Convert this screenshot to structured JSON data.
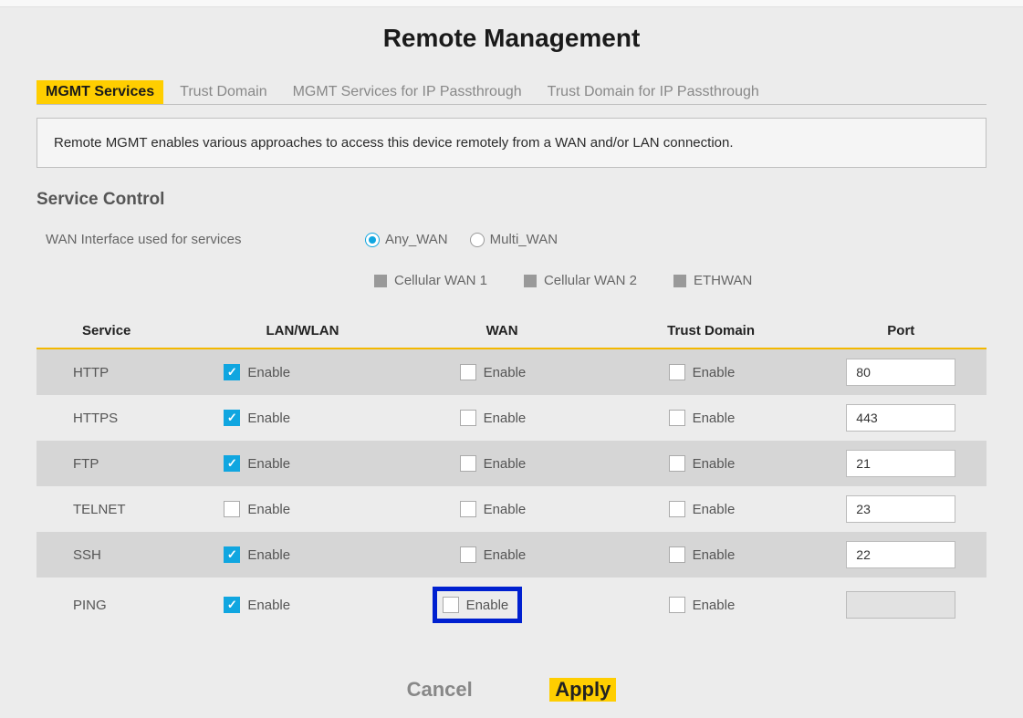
{
  "page": {
    "title": "Remote Management"
  },
  "tabs": {
    "items": [
      {
        "label": "MGMT Services",
        "active": true
      },
      {
        "label": "Trust Domain",
        "active": false
      },
      {
        "label": "MGMT Services for IP Passthrough",
        "active": false
      },
      {
        "label": "Trust Domain for IP Passthrough",
        "active": false
      }
    ]
  },
  "note": "Remote MGMT enables various approaches to access this device remotely from a WAN and/or LAN connection.",
  "section": {
    "title": "Service Control",
    "wan_label": "WAN Interface used for services",
    "wan_options": [
      {
        "label": "Any_WAN",
        "selected": true
      },
      {
        "label": "Multi_WAN",
        "selected": false
      }
    ],
    "legend": [
      {
        "label": "Cellular WAN 1"
      },
      {
        "label": "Cellular WAN 2"
      },
      {
        "label": "ETHWAN"
      }
    ]
  },
  "table": {
    "headers": [
      "Service",
      "LAN/WLAN",
      "WAN",
      "Trust Domain",
      "Port"
    ],
    "enable_label": "Enable",
    "rows": [
      {
        "service": "HTTP",
        "lan": true,
        "wan": false,
        "trust": false,
        "port": "80",
        "highlight_wan": false
      },
      {
        "service": "HTTPS",
        "lan": true,
        "wan": false,
        "trust": false,
        "port": "443",
        "highlight_wan": false
      },
      {
        "service": "FTP",
        "lan": true,
        "wan": false,
        "trust": false,
        "port": "21",
        "highlight_wan": false
      },
      {
        "service": "TELNET",
        "lan": false,
        "wan": false,
        "trust": false,
        "port": "23",
        "highlight_wan": false
      },
      {
        "service": "SSH",
        "lan": true,
        "wan": false,
        "trust": false,
        "port": "22",
        "highlight_wan": false
      },
      {
        "service": "PING",
        "lan": true,
        "wan": false,
        "trust": false,
        "port": "",
        "highlight_wan": true
      }
    ]
  },
  "actions": {
    "cancel": "Cancel",
    "apply": "Apply"
  }
}
